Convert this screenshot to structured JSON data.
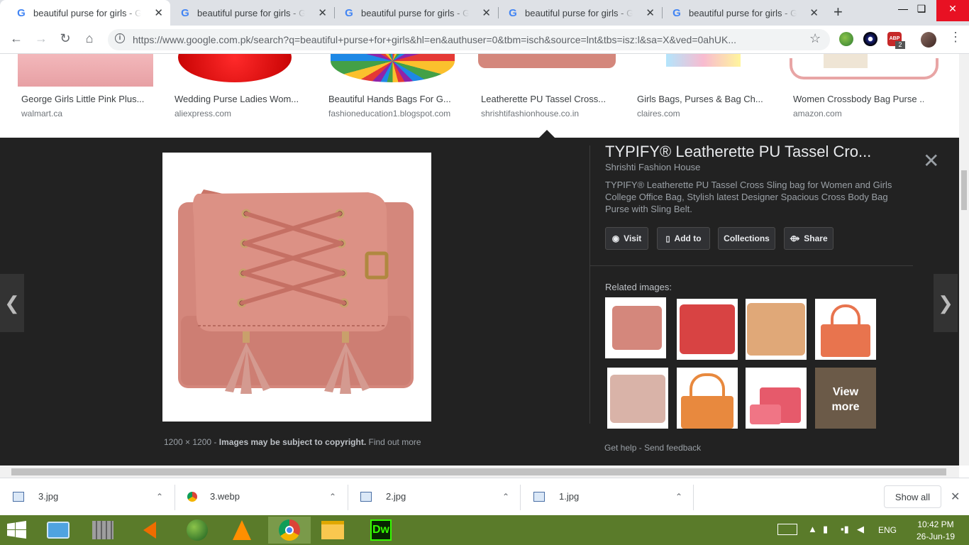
{
  "tabs": [
    {
      "title": "beautiful purse for girls - Google Search",
      "active": true
    },
    {
      "title": "beautiful purse for girls - Google Search",
      "active": false
    },
    {
      "title": "beautiful purse for girls - Google Search",
      "active": false
    },
    {
      "title": "beautiful purse for girls - Google Search",
      "active": false
    },
    {
      "title": "beautiful purse for girls - Google Search",
      "active": false
    }
  ],
  "toolbar": {
    "url": "https://www.google.com.pk/search?q=beautiful+purse+for+girls&hl=en&authuser=0&tbm=isch&source=lnt&tbs=isz:l&sa=X&ved=0ahUK...",
    "ext_badge_text": "ABP",
    "ext_badge_count": "2"
  },
  "results": [
    {
      "title": "George Girls Little Pink Plus...",
      "site": "walmart.ca"
    },
    {
      "title": "Wedding Purse Ladies Wom...",
      "site": "aliexpress.com"
    },
    {
      "title": "Beautiful Hands Bags For G...",
      "site": "fashioneducation1.blogspot.com"
    },
    {
      "title": "Leatherette PU Tassel Cross...",
      "site": "shrishtifashionhouse.co.in"
    },
    {
      "title": "Girls Bags, Purses & Bag Ch...",
      "site": "claires.com"
    },
    {
      "title": "Women Crossbody Bag Purse ...",
      "site": "amazon.com"
    }
  ],
  "preview": {
    "title": "TYPIFY® Leatherette PU Tassel Cro...",
    "site": "Shrishti Fashion House",
    "description": "TYPIFY® Leatherette PU Tassel Cross Sling bag for Women and Girls College Office Bag, Stylish latest Designer Spacious Cross Body Bag Purse with Sling Belt.",
    "buttons": {
      "visit": "Visit",
      "add_to": "Add to",
      "collections": "Collections",
      "share": "Share"
    },
    "related_label": "Related images:",
    "view_more_line1": "View",
    "view_more_line2": "more",
    "dimensions": "1200 × 1200",
    "meta_sep": "-",
    "copyright": "Images may be subject to copyright.",
    "find_out_more": "Find out more",
    "get_help": "Get help",
    "help_sep": "-",
    "send_feedback": "Send feedback"
  },
  "downloads": {
    "items": [
      "3.jpg",
      "3.webp",
      "2.jpg",
      "1.jpg"
    ],
    "show_all": "Show all"
  },
  "taskbar": {
    "lang": "ENG",
    "time": "10:42 PM",
    "date": "26-Jun-19",
    "apps": [
      "display-settings",
      "network-tool",
      "volume",
      "internet-globe",
      "vlc",
      "chrome",
      "file-explorer",
      "dreamweaver"
    ],
    "dw_label": "Dw"
  },
  "colors": {
    "panel_bg": "#222222",
    "purse_pink": "#d4877c",
    "taskbar_green": "#5a7b2a"
  }
}
